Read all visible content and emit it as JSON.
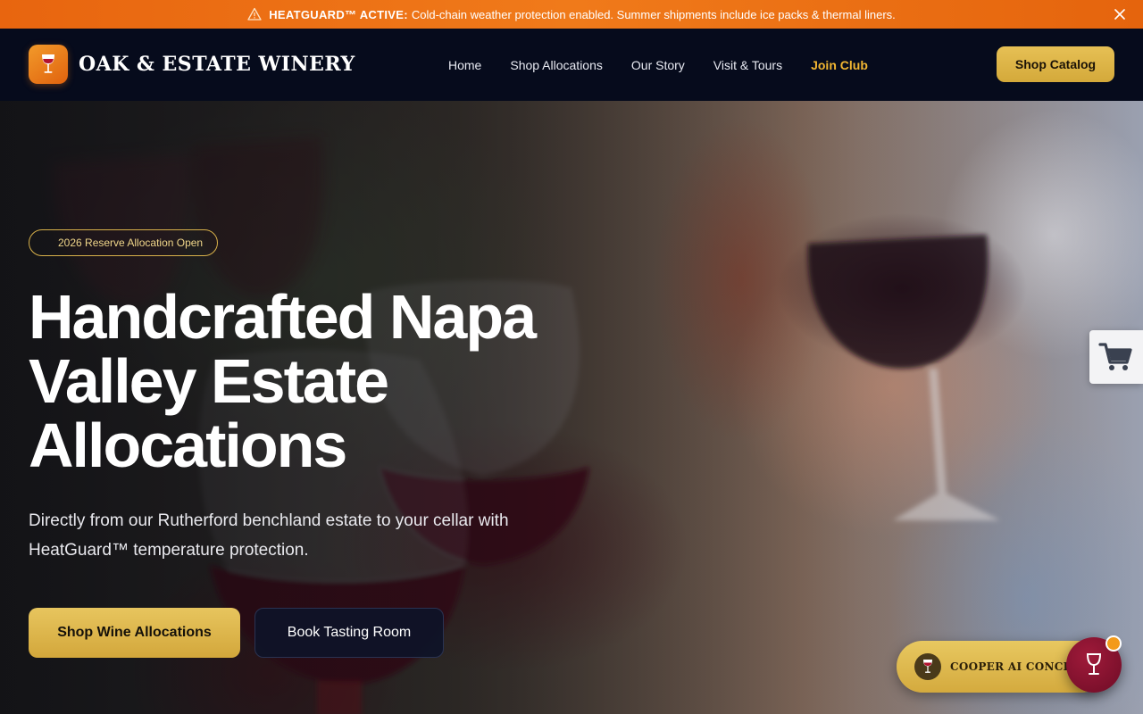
{
  "banner": {
    "icon": "warning-icon",
    "strong": "HEATGUARD™ ACTIVE:",
    "text": "Cold-chain weather protection enabled. Summer shipments include ice packs & thermal liners."
  },
  "brand": {
    "name": "OAK & ESTATE WINERY",
    "logo_icon": "wine-glass-icon"
  },
  "nav": {
    "items": [
      {
        "label": "Home"
      },
      {
        "label": "Shop Allocations"
      },
      {
        "label": "Our Story"
      },
      {
        "label": "Visit & Tours"
      },
      {
        "label": "Join Club"
      }
    ],
    "cta": "Shop Catalog"
  },
  "hero": {
    "pill": "2026 Reserve Allocation Open",
    "headline": "Handcrafted Napa Valley Estate Allocations",
    "subtitle": "Directly from our Rutherford benchland estate to your cellar with HeatGuard™ temperature protection.",
    "primary_cta": "Shop Wine Allocations",
    "secondary_cta": "Book Tasting Room"
  },
  "concierge": {
    "label": "COOPER AI CONCIERGE"
  },
  "colors": {
    "accent_gold": "#d9b145",
    "banner_orange": "#ec6f14",
    "header_navy": "#060b1c",
    "join_club": "#f2b632",
    "concierge_burgundy": "#8a1230"
  }
}
